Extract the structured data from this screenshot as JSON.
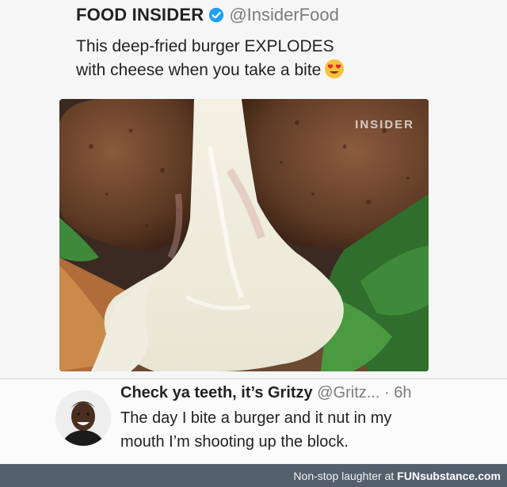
{
  "tweet": {
    "author_name": "FOOD INSIDER",
    "handle": "@InsiderFood",
    "text_line1": "This deep-fried burger EXPLODES",
    "text_line2": "with cheese when you take a bite",
    "emoji_icon": "heart-eyes-emoji",
    "verified_icon": "verified-badge-icon",
    "media_watermark": "INSIDER"
  },
  "reply": {
    "author_name": "Check ya teeth, it’s Gritzy",
    "handle": "@Gritz...",
    "time": "· 6h",
    "text_line1": "The day I bite a burger and it nut in my",
    "text_line2": "mouth I’m shooting up the block."
  },
  "footer": {
    "text": "Non-stop laughter at",
    "brand_fun": "FUN",
    "brand_sub": "substance.com"
  },
  "colors": {
    "verified_blue": "#1da1f2",
    "footer_bg": "#54606c",
    "handle_gray": "#7b7b7b"
  }
}
